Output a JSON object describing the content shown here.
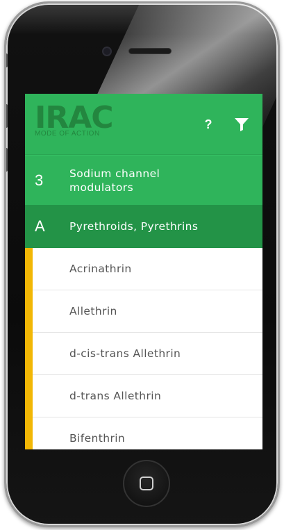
{
  "app": {
    "logo_text": "IRAC",
    "logo_subtitle": "MODE OF ACTION",
    "help_label": "?",
    "filter_icon": "filter-icon"
  },
  "category": {
    "code": "3",
    "label": "Sodium channel modulators"
  },
  "subgroup": {
    "code": "A",
    "label": "Pyrethroids, Pyrethrins"
  },
  "items": [
    {
      "label": "Acrinathrin"
    },
    {
      "label": "Allethrin"
    },
    {
      "label": "d-cis-trans Allethrin"
    },
    {
      "label": "d-trans Allethrin"
    },
    {
      "label": "Bifenthrin"
    }
  ],
  "colors": {
    "header_green": "#2fb45b",
    "subgroup_green": "#239347",
    "accent_yellow": "#f2b705",
    "logo_green": "#23863f"
  }
}
